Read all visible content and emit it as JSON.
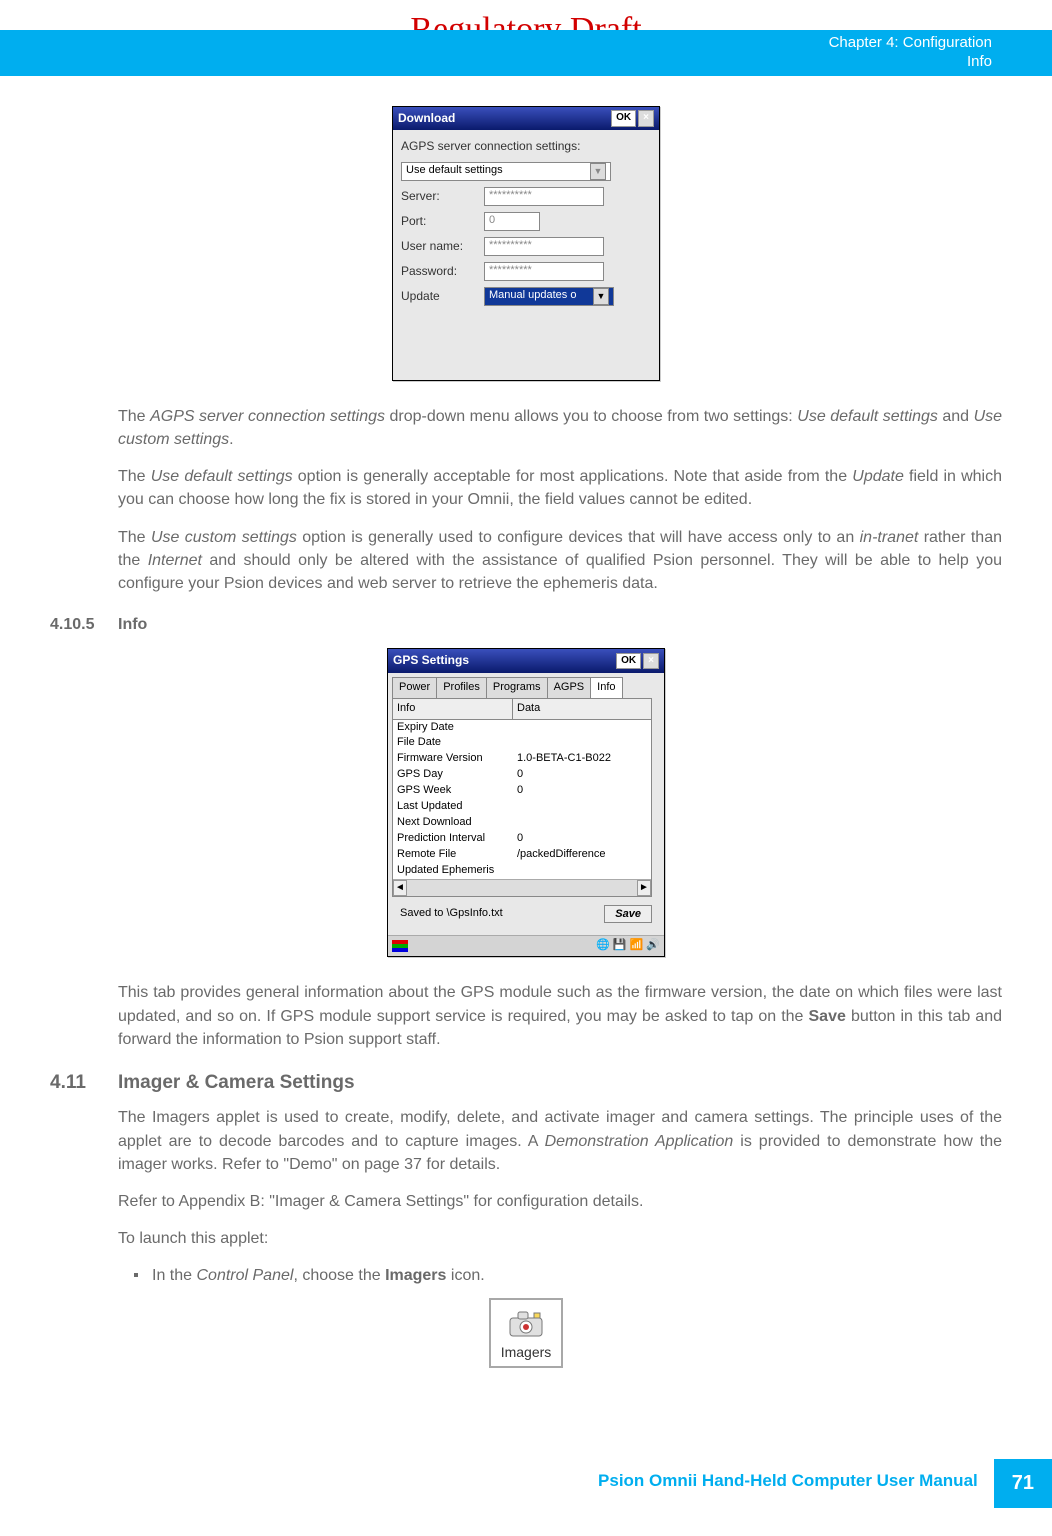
{
  "watermark": "Regulatory Draft",
  "header": {
    "chapter": "Chapter 4:  Configuration",
    "sub": "Info"
  },
  "dlg1": {
    "title": "Download",
    "ok": "OK",
    "x": "×",
    "label_conn": "AGPS server connection settings:",
    "conn_value": "Use default settings",
    "rows": {
      "server": "Server:",
      "port": "Port:",
      "user": "User name:",
      "pass": "Password:",
      "update": "Update"
    },
    "vals": {
      "server": "**********",
      "port": "0",
      "user": "**********",
      "pass": "**********",
      "update": "Manual updates o"
    }
  },
  "p1": {
    "a": "The  ",
    "b": "AGPS server connection settings",
    "c": " drop-down menu allows you to choose from two settings: ",
    "d": "Use default settings",
    "e": " and ",
    "f": "Use custom settings",
    "g": "."
  },
  "p2": {
    "a": "The ",
    "b": "Use default settings",
    "c": " option is generally acceptable for most applications. Note that aside from the ",
    "d": "Update",
    "e": " field in which you can choose how long the fix is stored in your Omnii, the field values cannot be edited."
  },
  "p3": {
    "a": "The ",
    "b": "Use custom settings",
    "c": " option is generally used to configure devices that will have access only to an ",
    "d": "in-tranet",
    "e": " rather than the ",
    "f": "Internet",
    "g": " and should only be altered with the assistance of qualified Psion personnel. They will be able to help you configure your Psion devices and web server to retrieve the ephemeris data."
  },
  "sec1": {
    "num": "4.10.5",
    "title": "Info"
  },
  "dlg2": {
    "title": "GPS Settings",
    "ok": "OK",
    "x": "×",
    "tabs": [
      "Power",
      "Profiles",
      "Programs",
      "AGPS",
      "Info"
    ],
    "head": [
      "Info",
      "Data"
    ],
    "rows": [
      [
        "Expiry Date",
        ""
      ],
      [
        "File Date",
        ""
      ],
      [
        "Firmware Version",
        "1.0-BETA-C1-B022"
      ],
      [
        "GPS Day",
        "0"
      ],
      [
        "GPS Week",
        "0"
      ],
      [
        "Last Updated",
        ""
      ],
      [
        "Next Download",
        ""
      ],
      [
        "Prediction Interval",
        "0"
      ],
      [
        "Remote File",
        "/packedDifference"
      ],
      [
        "Updated Ephemeris",
        ""
      ]
    ],
    "saved": "Saved to \\GpsInfo.txt",
    "save": "Save"
  },
  "p4": {
    "a": "This tab provides general information about the GPS module such as the firmware version, the date on which files were last updated, and so on. If GPS module support service is required, you may be asked to tap on the ",
    "b": "Save",
    "c": " button in this tab and forward the information to Psion support staff."
  },
  "sec2": {
    "num": "4.11",
    "title": "Imager & Camera Settings"
  },
  "p5": {
    "a": "The Imagers applet is used to create, modify, delete, and activate imager and camera settings. The principle uses of the applet are to decode barcodes and to capture images. A ",
    "b": "Demonstration Application",
    "c": " is provided to demonstrate how the imager works. Refer to \"Demo\" on page 37 for details."
  },
  "p6": "Refer to Appendix B: \"Imager & Camera Settings\" for configuration details.",
  "p7": "To launch this applet:",
  "bul": {
    "a": "In the ",
    "b": "Control Panel",
    "c": ", choose the ",
    "d": "Imagers",
    "e": " icon."
  },
  "icon_cap": "Imagers",
  "footer": {
    "text": "Psion Omnii Hand-Held Computer User Manual",
    "page": "71"
  }
}
